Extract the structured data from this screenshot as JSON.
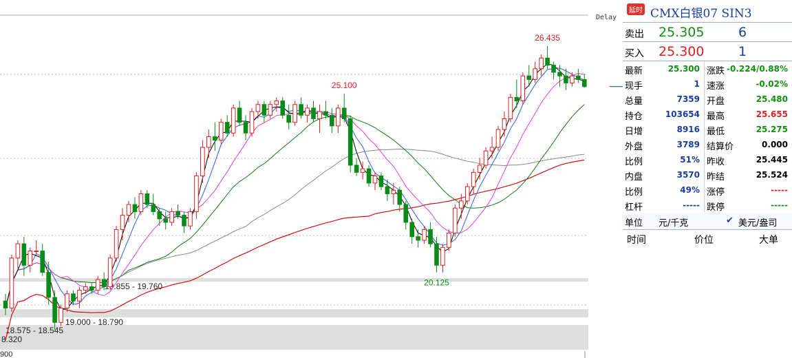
{
  "delay_label": "Delay",
  "header": {
    "badge": "延时",
    "title": "CMX白银07  SIN3"
  },
  "quote": {
    "ask": {
      "label": "卖出",
      "price": "25.305",
      "volume": "6"
    },
    "bid": {
      "label": "买入",
      "price": "25.300",
      "volume": "1"
    }
  },
  "stats": [
    {
      "k": "最新",
      "v": "25.300",
      "color": "#109010"
    },
    {
      "k": "涨跌",
      "v": "-0.224/0.88%",
      "color": "#109010"
    },
    {
      "k": "现手",
      "v": "1",
      "color": "#1a3c9e"
    },
    {
      "k": "速涨",
      "v": "-0.02%",
      "color": "#109010"
    },
    {
      "k": "总量",
      "v": "7359",
      "color": "#1a3c9e"
    },
    {
      "k": "开盘",
      "v": "25.480",
      "color": "#109010"
    },
    {
      "k": "持仓",
      "v": "103654",
      "color": "#1a3c9e"
    },
    {
      "k": "最高",
      "v": "25.655",
      "color": "#e02020"
    },
    {
      "k": "日增",
      "v": "8916",
      "color": "#1a3c9e"
    },
    {
      "k": "最低",
      "v": "25.275",
      "color": "#109010"
    },
    {
      "k": "外盘",
      "v": "3789",
      "color": "#1a3c9e"
    },
    {
      "k": "结算价",
      "v": "0.000",
      "color": "#000000"
    },
    {
      "k": "比例",
      "v": "51%",
      "color": "#1a3c9e"
    },
    {
      "k": "昨收",
      "v": "25.445",
      "color": "#000000"
    },
    {
      "k": "内盘",
      "v": "3570",
      "color": "#1a3c9e"
    },
    {
      "k": "昨结",
      "v": "25.524",
      "color": "#000000"
    },
    {
      "k": "比例",
      "v": "49%",
      "color": "#1a3c9e"
    },
    {
      "k": "涨停",
      "v": "-----",
      "color": "#e02020"
    },
    {
      "k": "杠杆",
      "v": "-----",
      "color": "#1a3c9e"
    },
    {
      "k": "跌停",
      "v": "-----",
      "color": "#109010"
    }
  ],
  "units": {
    "label": "单位",
    "value1": "元/千克",
    "check": "✔",
    "value2": "美元/盎司"
  },
  "trade_table": {
    "time": "时间",
    "price": "价位",
    "size": "大单"
  },
  "colors": {
    "up": "#d62020",
    "down": "#0a8a18",
    "ma5": "#000000",
    "ma10": "#2f5fe0",
    "ma20": "#e040e0",
    "ma40": "#137a13",
    "ma60": "#888888",
    "ma120": "#cc1010"
  },
  "chart_data": {
    "type": "candlestick",
    "ylim": [
      17.8,
      27.3
    ],
    "annotations": [
      {
        "text": "26.435",
        "index": 88,
        "price": 26.435,
        "color": "#d62020",
        "pos": "above"
      },
      {
        "text": "25.100",
        "index": 55,
        "price": 25.1,
        "color": "#d62020",
        "pos": "above"
      },
      {
        "text": "20.125",
        "index": 70,
        "price": 20.125,
        "color": "#0a8a18",
        "pos": "below"
      }
    ],
    "zones": [
      {
        "low": 19.76,
        "high": 19.855,
        "label": "19.855 - 19.760"
      },
      {
        "low": 18.79,
        "high": 19.0,
        "label": "19.000 - 18.790"
      },
      {
        "low": 17.6,
        "high": 18.545,
        "label": "18.575 - 18.545"
      }
    ],
    "left_edge_labels": [
      "8.320",
      "900"
    ],
    "candles": [
      [
        19.3,
        19.5,
        18.9,
        19.1
      ],
      [
        19.1,
        20.6,
        19.0,
        20.5
      ],
      [
        20.5,
        21.0,
        20.2,
        20.9
      ],
      [
        20.9,
        21.1,
        20.0,
        20.3
      ],
      [
        20.3,
        20.8,
        20.1,
        20.7
      ],
      [
        20.7,
        21.0,
        20.6,
        20.7
      ],
      [
        20.7,
        20.9,
        20.0,
        20.1
      ],
      [
        20.1,
        20.4,
        19.2,
        19.4
      ],
      [
        19.4,
        19.6,
        18.5,
        18.7
      ],
      [
        18.7,
        19.2,
        18.6,
        19.1
      ],
      [
        19.1,
        19.6,
        19.0,
        19.5
      ],
      [
        19.5,
        19.6,
        19.2,
        19.3
      ],
      [
        19.3,
        19.7,
        19.1,
        19.6
      ],
      [
        19.6,
        19.8,
        19.5,
        19.7
      ],
      [
        19.7,
        19.8,
        19.5,
        19.6
      ],
      [
        19.6,
        20.0,
        19.5,
        19.9
      ],
      [
        19.9,
        20.1,
        19.6,
        19.7
      ],
      [
        19.7,
        20.6,
        19.6,
        20.5
      ],
      [
        20.5,
        21.4,
        20.4,
        21.3
      ],
      [
        21.3,
        21.9,
        21.0,
        21.7
      ],
      [
        21.7,
        22.1,
        21.5,
        22.0
      ],
      [
        22.0,
        22.2,
        21.6,
        21.8
      ],
      [
        21.8,
        22.4,
        21.7,
        22.3
      ],
      [
        22.3,
        22.4,
        21.9,
        22.0
      ],
      [
        22.0,
        22.3,
        21.7,
        21.8
      ],
      [
        21.8,
        21.9,
        21.4,
        21.6
      ],
      [
        21.6,
        21.8,
        21.3,
        21.5
      ],
      [
        21.5,
        21.9,
        21.4,
        21.8
      ],
      [
        21.8,
        22.0,
        21.6,
        21.7
      ],
      [
        21.7,
        21.8,
        21.2,
        21.4
      ],
      [
        21.4,
        21.9,
        21.3,
        21.8
      ],
      [
        21.8,
        22.9,
        21.6,
        22.8
      ],
      [
        22.8,
        23.8,
        22.6,
        23.6
      ],
      [
        23.6,
        24.1,
        23.3,
        23.9
      ],
      [
        23.9,
        24.3,
        23.5,
        23.8
      ],
      [
        23.8,
        24.4,
        23.7,
        24.3
      ],
      [
        24.3,
        24.5,
        23.9,
        24.0
      ],
      [
        24.0,
        24.8,
        23.9,
        24.7
      ],
      [
        24.7,
        24.9,
        24.2,
        24.3
      ],
      [
        24.3,
        24.5,
        23.8,
        24.0
      ],
      [
        24.0,
        24.7,
        23.9,
        24.6
      ],
      [
        24.6,
        24.9,
        24.4,
        24.8
      ],
      [
        24.8,
        24.9,
        24.3,
        24.5
      ],
      [
        24.5,
        24.9,
        24.4,
        24.8
      ],
      [
        24.8,
        25.0,
        24.6,
        24.9
      ],
      [
        24.9,
        25.0,
        24.4,
        24.5
      ],
      [
        24.5,
        24.8,
        24.1,
        24.3
      ],
      [
        24.3,
        24.9,
        24.2,
        24.8
      ],
      [
        24.8,
        25.0,
        24.4,
        24.5
      ],
      [
        24.5,
        24.8,
        24.3,
        24.7
      ],
      [
        24.7,
        24.9,
        24.3,
        24.4
      ],
      [
        24.4,
        24.8,
        24.0,
        24.6
      ],
      [
        24.6,
        24.9,
        24.4,
        24.5
      ],
      [
        24.5,
        24.7,
        24.0,
        24.2
      ],
      [
        24.2,
        24.8,
        24.0,
        24.7
      ],
      [
        24.7,
        25.1,
        24.3,
        24.4
      ],
      [
        24.4,
        24.5,
        22.9,
        23.1
      ],
      [
        23.1,
        23.3,
        22.8,
        22.9
      ],
      [
        22.9,
        23.2,
        22.7,
        23.0
      ],
      [
        23.0,
        23.1,
        22.5,
        22.6
      ],
      [
        22.6,
        22.9,
        22.4,
        22.8
      ],
      [
        22.8,
        22.9,
        22.4,
        22.5
      ],
      [
        22.5,
        22.7,
        22.1,
        22.3
      ],
      [
        22.3,
        22.6,
        22.0,
        22.4
      ],
      [
        22.4,
        22.5,
        21.8,
        22.0
      ],
      [
        22.0,
        22.1,
        21.3,
        21.5
      ],
      [
        21.5,
        21.6,
        20.9,
        21.1
      ],
      [
        21.1,
        21.3,
        20.8,
        21.0
      ],
      [
        21.0,
        21.4,
        20.9,
        21.3
      ],
      [
        21.3,
        21.5,
        20.8,
        20.9
      ],
      [
        20.9,
        21.1,
        20.1,
        20.3
      ],
      [
        20.3,
        20.9,
        20.1,
        20.8
      ],
      [
        20.8,
        21.3,
        20.7,
        21.2
      ],
      [
        21.2,
        22.0,
        21.1,
        21.9
      ],
      [
        21.9,
        22.3,
        21.6,
        22.1
      ],
      [
        22.1,
        22.6,
        22.0,
        22.5
      ],
      [
        22.5,
        23.0,
        22.3,
        22.9
      ],
      [
        22.9,
        23.3,
        22.7,
        23.1
      ],
      [
        23.1,
        23.6,
        23.0,
        23.5
      ],
      [
        23.5,
        23.9,
        23.3,
        23.6
      ],
      [
        23.6,
        24.2,
        23.5,
        24.1
      ],
      [
        24.1,
        24.6,
        23.9,
        24.4
      ],
      [
        24.4,
        25.1,
        24.3,
        25.0
      ],
      [
        25.0,
        25.5,
        24.7,
        24.9
      ],
      [
        24.9,
        25.7,
        24.8,
        25.6
      ],
      [
        25.6,
        25.9,
        25.3,
        25.5
      ],
      [
        25.5,
        26.0,
        25.4,
        25.8
      ],
      [
        25.8,
        26.2,
        25.6,
        26.1
      ],
      [
        26.1,
        26.435,
        25.8,
        25.9
      ],
      [
        25.9,
        26.0,
        25.5,
        25.7
      ],
      [
        25.7,
        25.9,
        25.3,
        25.6
      ],
      [
        25.6,
        25.8,
        25.2,
        25.4
      ],
      [
        25.4,
        25.7,
        25.3,
        25.6
      ],
      [
        25.6,
        25.8,
        25.4,
        25.5
      ],
      [
        25.5,
        25.655,
        25.275,
        25.3
      ]
    ]
  }
}
